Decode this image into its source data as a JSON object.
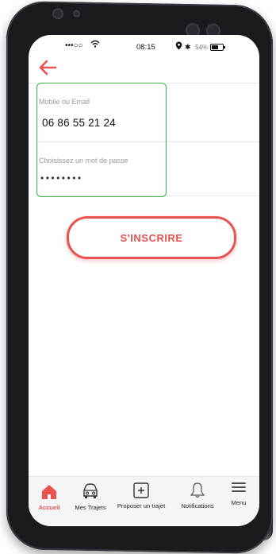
{
  "status_bar": {
    "signal": "•••○○",
    "time": "08:15",
    "battery": "54%"
  },
  "form": {
    "login_label": "Mobile ou Email",
    "login_value": "06 86 55 21 24",
    "password_label": "Choisissez un mot de passe",
    "password_value": "••••••••"
  },
  "signup_button": "S'INSCRIRE",
  "tabs": [
    {
      "label": "Accueil",
      "icon": "home-icon",
      "active": true
    },
    {
      "label": "Mes Trajets",
      "icon": "car-icon",
      "active": false
    },
    {
      "label": "Proposer un trajet",
      "icon": "plus-square-icon",
      "active": false
    },
    {
      "label": "Notifications",
      "icon": "bell-icon",
      "active": false
    },
    {
      "label": "Menu",
      "icon": "menu-icon",
      "active": false
    }
  ],
  "colors": {
    "accent": "#e9534f",
    "focus_border": "#3fb24a",
    "brand_arc": "#14b8d4"
  }
}
